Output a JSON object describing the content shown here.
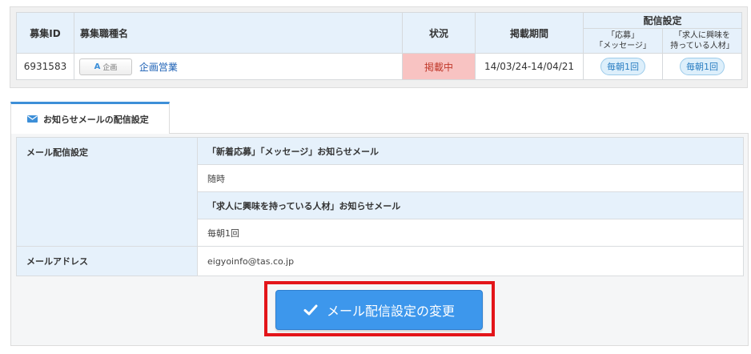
{
  "job_table": {
    "headers": {
      "id": "募集ID",
      "name": "募集職種名",
      "status": "状況",
      "period": "掲載期間",
      "delivery": "配信設定",
      "delivery_sub_1": "「応募」\n「メッセージ」",
      "delivery_sub_2": "「求人に興味を\n持っている人材」"
    },
    "row": {
      "id": "6931583",
      "kind_badge_letter": "A",
      "kind_badge_label": "企画",
      "name": "企画営業",
      "status": "掲載中",
      "period": "14/03/24-14/04/21",
      "delivery_1": "毎朝1回",
      "delivery_2": "毎朝1回"
    }
  },
  "tab": {
    "label": "お知らせメールの配信設定",
    "icon": "envelope-icon"
  },
  "settings": {
    "mail_delivery_label": "メール配信設定",
    "section_1_title": "「新着応募」「メッセージ」お知らせメール",
    "section_1_value": "随時",
    "section_2_title": "「求人に興味を持っている人材」お知らせメール",
    "section_2_value": "毎朝1回",
    "address_label": "メールアドレス",
    "address_value": "eigyoinfo@tas.co.jp"
  },
  "action": {
    "label": "メール配信設定の変更",
    "icon": "check-icon"
  },
  "colors": {
    "accent": "#3d97ec",
    "header_bg": "#e6f1fb",
    "status_bg": "#f8c3c2",
    "highlight": "#e3151a"
  }
}
